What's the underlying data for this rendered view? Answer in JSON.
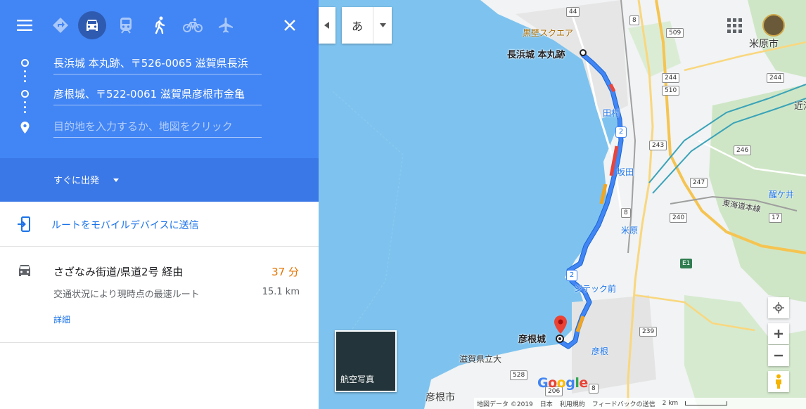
{
  "panel": {
    "travel_modes": [
      {
        "name": "best-mode",
        "state": "dim"
      },
      {
        "name": "driving",
        "state": "active"
      },
      {
        "name": "transit",
        "state": "dim"
      },
      {
        "name": "walking",
        "state": "normal"
      },
      {
        "name": "cycling",
        "state": "dim"
      },
      {
        "name": "flights",
        "state": "dim"
      }
    ],
    "origin": "長浜城 本丸跡、〒526-0065 滋賀県長浜",
    "destination": "彦根城、〒522-0061 滋賀県彦根市金亀",
    "add_placeholder": "目的地を入力するか、地図をクリック",
    "depart": "すぐに出発",
    "send_to_device": "ルートをモバイルデバイスに送信",
    "route": {
      "via": "さざなみ街道/県道2号 経由",
      "time": "37 分",
      "note": "交通状況により現時点の最速ルート",
      "distance": "15.1 km",
      "details": "詳細"
    }
  },
  "map": {
    "ime_char": "あ",
    "labels": {
      "origin_name": "長浜城 本丸跡",
      "dest_name": "彦根城",
      "maibara_city": "米原市",
      "hikone_city": "彦根市",
      "kurokabe": "黒壁スクエア",
      "tamura": "田村",
      "sakata": "坂田",
      "maibara_station": "米原",
      "biwako_line": "東海道本線",
      "jitech": "ジテック前",
      "hikone_station": "彦根",
      "univ": "滋賀県立大",
      "samegai": "醒ケ井",
      "ohmi": "近江"
    },
    "satellite_label": "航空写真",
    "google": "Google",
    "footer": {
      "data": "地図データ ©2019",
      "japan": "日本",
      "terms": "利用規約",
      "feedback": "フィードバックの送信",
      "scale": "2 km"
    }
  },
  "colors": {
    "panel_blue": "#4285f4",
    "depart_blue": "#3b78e7",
    "route_blue": "#4285f4",
    "time_orange": "#e37400",
    "link_blue": "#1a73e8"
  }
}
